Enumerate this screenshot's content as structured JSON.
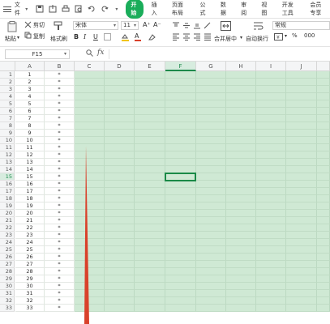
{
  "menubar": {
    "file_label": "文件",
    "tabs": [
      {
        "label": "开始",
        "active": true
      },
      {
        "label": "插入",
        "active": false
      },
      {
        "label": "页面布局",
        "active": false
      },
      {
        "label": "公式",
        "active": false
      },
      {
        "label": "数据",
        "active": false
      },
      {
        "label": "审阅",
        "active": false
      },
      {
        "label": "视图",
        "active": false
      },
      {
        "label": "开发工具",
        "active": false
      },
      {
        "label": "会员专享",
        "active": false
      }
    ]
  },
  "ribbon": {
    "paste_label": "粘贴",
    "cut_label": "剪切",
    "copy_label": "复制",
    "format_painter_label": "格式刷",
    "font_name": "宋体",
    "font_size": "11",
    "merge_label": "合并居中",
    "wrap_label": "自动换行",
    "number_format": "常规",
    "bold": "B",
    "italic": "I",
    "underline": "U"
  },
  "formula_bar": {
    "name_box": "F15",
    "fx_label": "fx",
    "formula_value": ""
  },
  "sheet": {
    "columns": [
      "A",
      "B",
      "C",
      "D",
      "E",
      "F",
      "G",
      "H",
      "I",
      "J"
    ],
    "active_column": "F",
    "active_row": 15,
    "rows": [
      {
        "n": "1",
        "a": "1",
        "b": "*"
      },
      {
        "n": "2",
        "a": "2",
        "b": "*"
      },
      {
        "n": "3",
        "a": "3",
        "b": "*"
      },
      {
        "n": "4",
        "a": "4",
        "b": "*"
      },
      {
        "n": "5",
        "a": "5",
        "b": "*"
      },
      {
        "n": "6",
        "a": "6",
        "b": "*"
      },
      {
        "n": "7",
        "a": "7",
        "b": "*"
      },
      {
        "n": "8",
        "a": "8",
        "b": "*"
      },
      {
        "n": "9",
        "a": "9",
        "b": "*"
      },
      {
        "n": "10",
        "a": "10",
        "b": "*"
      },
      {
        "n": "11",
        "a": "11",
        "b": "*"
      },
      {
        "n": "12",
        "a": "12",
        "b": "*"
      },
      {
        "n": "13",
        "a": "13",
        "b": "*"
      },
      {
        "n": "14",
        "a": "14",
        "b": "*"
      },
      {
        "n": "15",
        "a": "15",
        "b": "*"
      },
      {
        "n": "16",
        "a": "16",
        "b": "*"
      },
      {
        "n": "17",
        "a": "17",
        "b": "*"
      },
      {
        "n": "18",
        "a": "18",
        "b": "*"
      },
      {
        "n": "19",
        "a": "19",
        "b": "*"
      },
      {
        "n": "20",
        "a": "20",
        "b": "*"
      },
      {
        "n": "21",
        "a": "21",
        "b": "*"
      },
      {
        "n": "22",
        "a": "22",
        "b": "*"
      },
      {
        "n": "23",
        "a": "23",
        "b": "*"
      },
      {
        "n": "24",
        "a": "24",
        "b": "*"
      },
      {
        "n": "25",
        "a": "25",
        "b": "*"
      },
      {
        "n": "26",
        "a": "26",
        "b": "*"
      },
      {
        "n": "27",
        "a": "27",
        "b": "*"
      },
      {
        "n": "28",
        "a": "28",
        "b": "*"
      },
      {
        "n": "29",
        "a": "29",
        "b": "*"
      },
      {
        "n": "30",
        "a": "30",
        "b": "*"
      },
      {
        "n": "31",
        "a": "31",
        "b": "*"
      },
      {
        "n": "32",
        "a": "32",
        "b": "*"
      },
      {
        "n": "33",
        "a": "33",
        "b": "*"
      }
    ]
  },
  "colors": {
    "accent": "#1aad5a",
    "fill_green": "#cfe9d4",
    "selection": "#1a8a47",
    "shape_red": "#d9412b"
  }
}
